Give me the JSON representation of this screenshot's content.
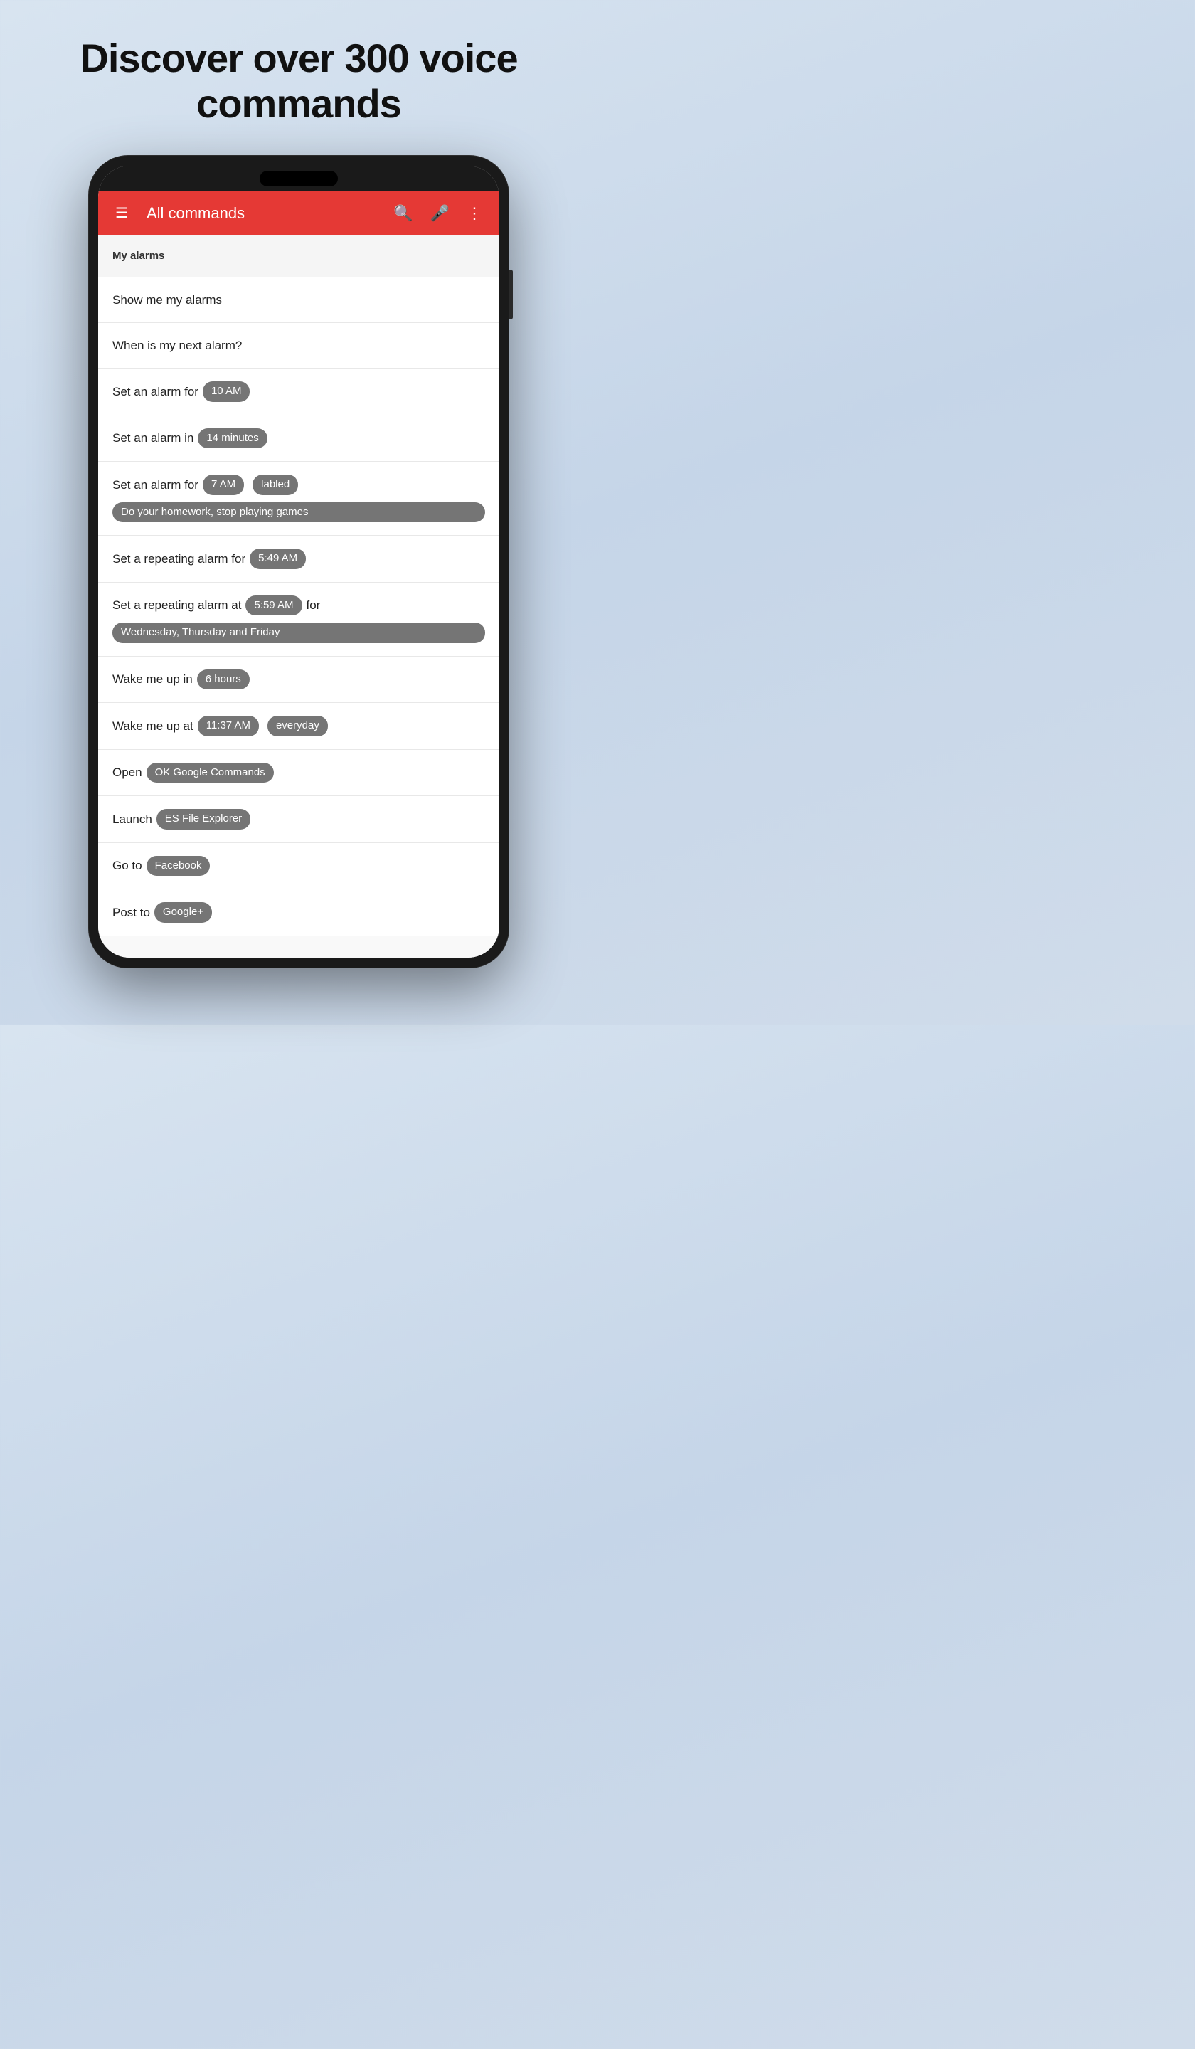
{
  "hero": {
    "title": "Discover over 300 voice commands"
  },
  "appBar": {
    "title": "All commands",
    "menuIcon": "☰",
    "searchIcon": "🔍",
    "micIcon": "🎤",
    "moreIcon": "⋮"
  },
  "commands": [
    {
      "id": "section-alarms",
      "type": "section",
      "text": "My alarms"
    },
    {
      "id": "cmd-show-alarms",
      "type": "plain",
      "text": "Show me my alarms"
    },
    {
      "id": "cmd-next-alarm",
      "type": "plain",
      "text": "When is my next alarm?"
    },
    {
      "id": "cmd-alarm-for",
      "type": "mixed",
      "parts": [
        {
          "t": "text",
          "v": "Set an alarm for "
        },
        {
          "t": "badge",
          "v": "10 AM"
        }
      ]
    },
    {
      "id": "cmd-alarm-in",
      "type": "mixed",
      "parts": [
        {
          "t": "text",
          "v": "Set an alarm in "
        },
        {
          "t": "badge",
          "v": "14 minutes"
        }
      ]
    },
    {
      "id": "cmd-alarm-labeled",
      "type": "mixed",
      "parts": [
        {
          "t": "text",
          "v": "Set an alarm for "
        },
        {
          "t": "badge",
          "v": "7 AM"
        },
        {
          "t": "text",
          "v": " "
        },
        {
          "t": "badge",
          "v": "labled"
        },
        {
          "t": "badge-block",
          "v": "Do your homework, stop playing games"
        }
      ]
    },
    {
      "id": "cmd-repeat-alarm-for",
      "type": "mixed",
      "parts": [
        {
          "t": "text",
          "v": "Set a repeating alarm for "
        },
        {
          "t": "badge",
          "v": "5:49 AM"
        }
      ]
    },
    {
      "id": "cmd-repeat-alarm-at",
      "type": "mixed",
      "parts": [
        {
          "t": "text",
          "v": "Set a repeating alarm at "
        },
        {
          "t": "badge",
          "v": "5:59 AM"
        },
        {
          "t": "text",
          "v": " for"
        },
        {
          "t": "badge-block",
          "v": "Wednesday, Thursday and Friday"
        }
      ]
    },
    {
      "id": "cmd-wake-hours",
      "type": "mixed",
      "parts": [
        {
          "t": "text",
          "v": "Wake me up in "
        },
        {
          "t": "badge",
          "v": "6 hours"
        }
      ]
    },
    {
      "id": "cmd-wake-at",
      "type": "mixed",
      "parts": [
        {
          "t": "text",
          "v": "Wake me up at "
        },
        {
          "t": "badge",
          "v": "11:37 AM"
        },
        {
          "t": "text",
          "v": " "
        },
        {
          "t": "badge",
          "v": "everyday"
        }
      ]
    },
    {
      "id": "cmd-open-app",
      "type": "mixed",
      "parts": [
        {
          "t": "text",
          "v": "Open "
        },
        {
          "t": "badge",
          "v": "OK Google Commands"
        }
      ]
    },
    {
      "id": "cmd-launch-app",
      "type": "mixed",
      "parts": [
        {
          "t": "text",
          "v": "Launch "
        },
        {
          "t": "badge",
          "v": "ES File Explorer"
        }
      ]
    },
    {
      "id": "cmd-goto",
      "type": "mixed",
      "parts": [
        {
          "t": "text",
          "v": "Go to "
        },
        {
          "t": "badge",
          "v": "Facebook"
        }
      ]
    },
    {
      "id": "cmd-post-to",
      "type": "mixed",
      "parts": [
        {
          "t": "text",
          "v": "Post to "
        },
        {
          "t": "badge",
          "v": "Google+"
        }
      ]
    }
  ],
  "fab": {
    "icon": "🎤"
  }
}
